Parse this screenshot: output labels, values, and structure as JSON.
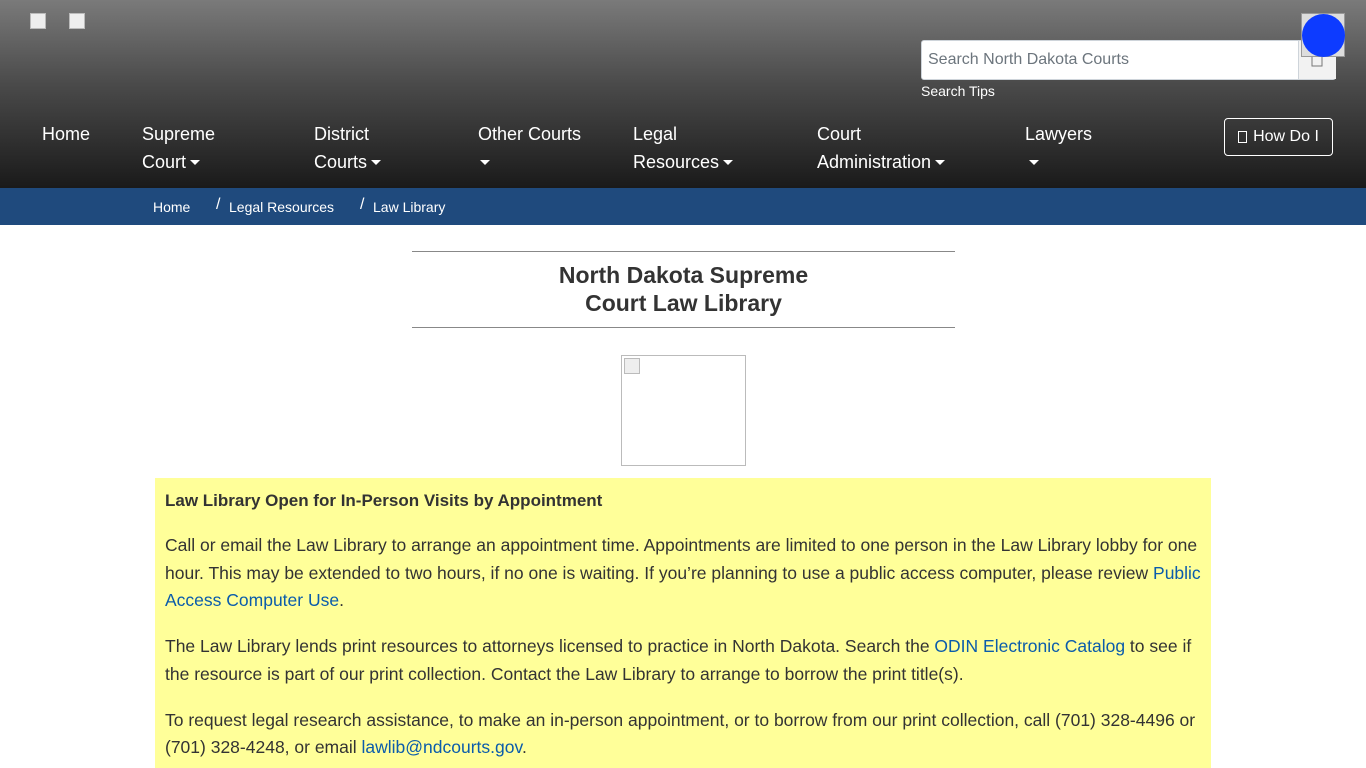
{
  "header": {
    "search": {
      "placeholder": "Search North Dakota Courts",
      "tips_label": "Search Tips"
    },
    "nav": {
      "home": "Home",
      "supreme_court": [
        "Supreme",
        "Court"
      ],
      "district_courts": [
        "District",
        "Courts"
      ],
      "other_courts": "Other Courts",
      "legal_resources": [
        "Legal",
        "Resources"
      ],
      "court_administration": [
        "Court",
        "Administration"
      ],
      "lawyers": "Lawyers"
    },
    "how_do_i_label": "How Do I"
  },
  "breadcrumb": {
    "items": [
      "Home",
      "Legal Resources",
      "Law Library"
    ],
    "separator": "/"
  },
  "page": {
    "title_line1": "North Dakota Supreme",
    "title_line2": "Court Law Library"
  },
  "notice": {
    "background_color": "#ffff99",
    "heading": "Law Library Open for In-Person Visits by Appointment",
    "p1_text": "Call or email the Law Library to arrange an appointment time.  Appointments are limited to one person in the Law Library lobby for one hour.  This may be extended to two hours, if no one is waiting.  If you’re planning to use a public access computer, please review ",
    "p1_link": "Public Access Computer Use",
    "p1_end": ".",
    "p2_text": "The Law Library lends print resources to attorneys licensed to practice in North Dakota.  Search the ",
    "p2_link": "ODIN Electronic Catalog",
    "p2_end": " to see if the resource is part of our print collection.  Contact the Law Library to arrange to borrow the print title(s).",
    "p3_text": "To request legal research assistance, to make an in-person appointment, or to borrow from our print collection, call (701) 328-4496 or (701) 328-4248, or email ",
    "p3_link": "lawlib@ndcourts.gov",
    "p3_end": "."
  },
  "colors": {
    "breadcrumb_bar": "#1f4a7d",
    "link": "#0b5cab",
    "accent_dot": "#0d3bff"
  },
  "icons": [
    "search-icon",
    "caret-down-icon",
    "question-icon",
    "broken-image-icon"
  ]
}
